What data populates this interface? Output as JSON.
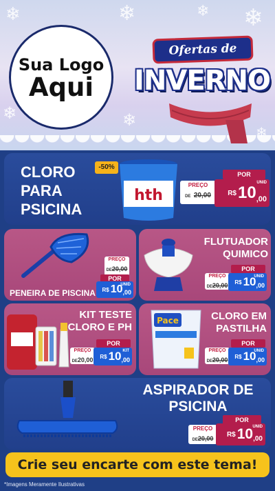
{
  "header": {
    "logo_line1": "Sua Logo",
    "logo_line2": "Aqui",
    "ofertas": "Ofertas de",
    "inverno": "INVERNO"
  },
  "products": [
    {
      "id": "cloro-psicina",
      "title": [
        "CLORO",
        "PARA",
        "PSICINA"
      ],
      "badge": "-50%",
      "preco_label": "PREÇO",
      "de": "DE",
      "old": "20,00",
      "por_label": "POR",
      "rs": "R$",
      "int": "10",
      "cents": ",00",
      "unid": "UNID",
      "brand": "hth"
    },
    {
      "id": "peneira",
      "title": [
        "PENEIRA DE PISCINA"
      ],
      "preco_label": "PREÇO",
      "de": "DE",
      "old": "20,00",
      "por_label": "POR",
      "rs": "R$",
      "int": "10",
      "cents": ",00",
      "unid": "UNID"
    },
    {
      "id": "flutuador",
      "title": [
        "FLUTUADOR",
        "QUIMICO"
      ],
      "preco_label": "PREÇO",
      "de": "DE",
      "old": "20,00",
      "por_label": "POR",
      "rs": "R$",
      "int": "10",
      "cents": ",00",
      "unid": "UNID"
    },
    {
      "id": "kit-teste",
      "title": [
        "KIT TESTE",
        "CLORO E PH"
      ],
      "preco_label": "PREÇO",
      "de": "DE",
      "old": "20,00",
      "por_label": "POR",
      "rs": "R$",
      "int": "10",
      "cents": ",00",
      "unid": "KIT"
    },
    {
      "id": "cloro-pastilha",
      "title": [
        "CLORO EM",
        "PASTILHA"
      ],
      "preco_label": "PREÇO",
      "de": "DE",
      "old": "20,00",
      "por_label": "POR",
      "rs": "R$",
      "int": "10",
      "cents": ",00",
      "unid": "UNID",
      "brand": "Pace"
    },
    {
      "id": "aspirador",
      "title": [
        "ASPIRADOR DE",
        "PSICINA"
      ],
      "preco_label": "PREÇO",
      "de": "DE",
      "old": "20,00",
      "por_label": "POR",
      "rs": "R$",
      "int": "10",
      "cents": ",00",
      "unid": "UNID"
    }
  ],
  "cta": "Crie seu encarte com este tema!",
  "footnote": "*Imagens Meramente Ilustrativas",
  "colors": {
    "navy": "#213f8b",
    "pink": "#a8477a",
    "yellow": "#f6c31c",
    "price_blue": "#1f5fd6",
    "por_red": "#b31d4c"
  }
}
